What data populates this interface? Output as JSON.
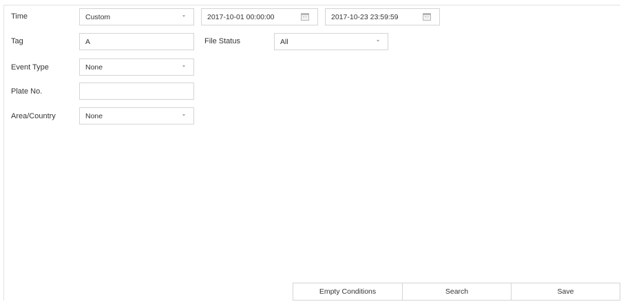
{
  "form": {
    "time": {
      "label": "Time",
      "mode": "Custom",
      "start": "2017-10-01 00:00:00",
      "end": "2017-10-23 23:59:59"
    },
    "tag": {
      "label": "Tag",
      "value": "A"
    },
    "file_status": {
      "label": "File Status",
      "value": "All"
    },
    "event_type": {
      "label": "Event Type",
      "value": "None"
    },
    "plate_no": {
      "label": "Plate No.",
      "value": ""
    },
    "area_country": {
      "label": "Area/Country",
      "value": "None"
    }
  },
  "buttons": {
    "empty": "Empty Conditions",
    "search": "Search",
    "save": "Save"
  },
  "icons": {
    "dropdown": "chevron-down-icon",
    "calendar": "calendar-icon"
  },
  "colors": {
    "border": "#d4d4d4",
    "text": "#333333",
    "background": "#ffffff"
  }
}
